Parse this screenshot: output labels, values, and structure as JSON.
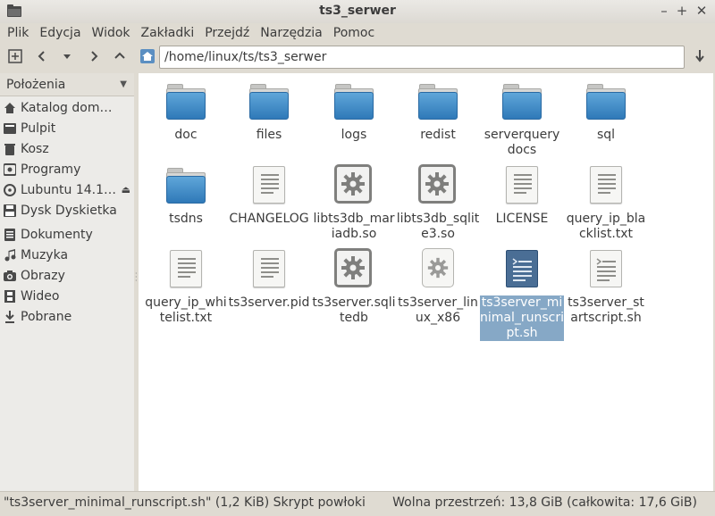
{
  "window": {
    "title": "ts3_serwer",
    "minimize_label": "–",
    "maximize_label": "+",
    "close_label": "✕"
  },
  "menu": [
    "Plik",
    "Edycja",
    "Widok",
    "Zakładki",
    "Przejdź",
    "Narzędzia",
    "Pomoc"
  ],
  "toolbar": {
    "path": "/home/linux/ts/ts3_serwer"
  },
  "sidebar": {
    "header": "Położenia",
    "items": [
      {
        "label": "Katalog dom…",
        "icon": "home-icon"
      },
      {
        "label": "Pulpit",
        "icon": "desktop-icon"
      },
      {
        "label": "Kosz",
        "icon": "trash-icon"
      },
      {
        "label": "Programy",
        "icon": "applications-icon"
      },
      {
        "label": "Lubuntu 14.1…",
        "icon": "cdrom-icon"
      },
      {
        "label": "Dysk Dyskietka",
        "icon": "floppy-icon"
      },
      {
        "label": "Dokumenty",
        "icon": "documents-icon"
      },
      {
        "label": "Muzyka",
        "icon": "music-icon"
      },
      {
        "label": "Obrazy",
        "icon": "pictures-icon"
      },
      {
        "label": "Wideo",
        "icon": "video-icon"
      },
      {
        "label": "Pobrane",
        "icon": "downloads-icon"
      }
    ]
  },
  "files": [
    {
      "name": "doc",
      "type": "folder"
    },
    {
      "name": "files",
      "type": "folder"
    },
    {
      "name": "logs",
      "type": "folder"
    },
    {
      "name": "redist",
      "type": "folder"
    },
    {
      "name": "serverquery docs",
      "type": "folder"
    },
    {
      "name": "sql",
      "type": "folder"
    },
    {
      "name": "tsdns",
      "type": "folder"
    },
    {
      "name": "CHANGELOG",
      "type": "text"
    },
    {
      "name": "libts3db_mariadb.so",
      "type": "library"
    },
    {
      "name": "libts3db_sqlite3.so",
      "type": "library"
    },
    {
      "name": "LICENSE",
      "type": "text"
    },
    {
      "name": "query_ip_blacklist.txt",
      "type": "text"
    },
    {
      "name": "query_ip_whitelist.txt",
      "type": "text"
    },
    {
      "name": "ts3server.pid",
      "type": "text"
    },
    {
      "name": "ts3server.sqlitedb",
      "type": "library"
    },
    {
      "name": "ts3server_linux_x86",
      "type": "executable"
    },
    {
      "name": "ts3server_minimal_runscript.sh",
      "type": "script",
      "selected": true
    },
    {
      "name": "ts3server_startscript.sh",
      "type": "script"
    }
  ],
  "status": {
    "selection": "\"ts3server_minimal_runscript.sh\" (1,2 KiB) Skrypt powłoki",
    "free_space": "Wolna przestrzeń: 13,8 GiB (całkowita: 17,6 GiB)"
  },
  "colors": {
    "selection": "#86a8c6",
    "folder_blue": "#3d87c4"
  }
}
